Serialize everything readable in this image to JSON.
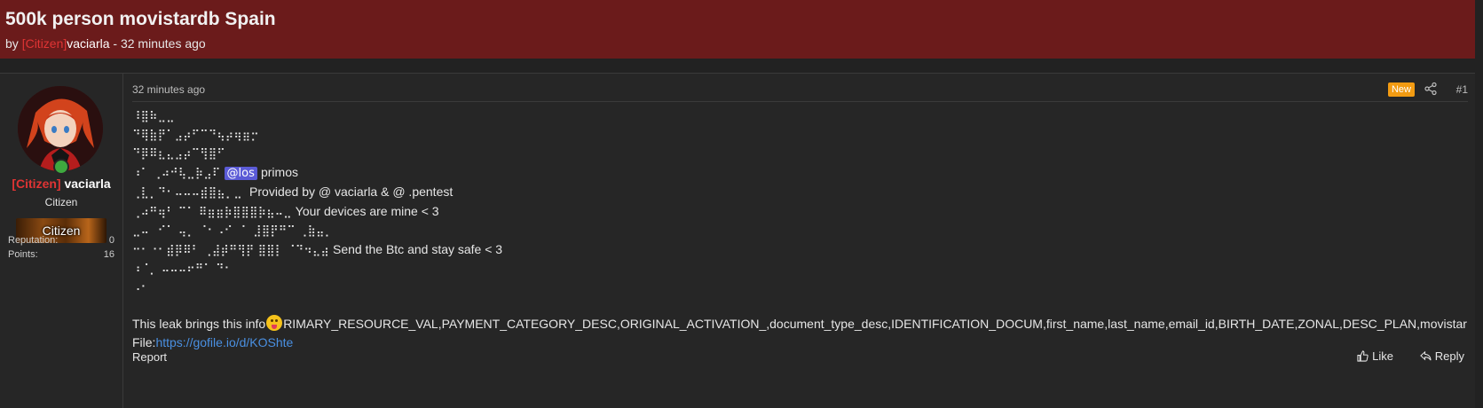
{
  "thread": {
    "title": "500k person movistardb Spain",
    "by_label": "by",
    "rank": "[Citizen]",
    "author": "vaciarla",
    "separator": "-",
    "time": "32 minutes ago"
  },
  "sidebar": {
    "rank": "[Citizen]",
    "username": "vaciarla",
    "user_title": "Citizen",
    "banner_text": "Citizen",
    "stats": [
      {
        "label": "Reputation:",
        "value": "0"
      },
      {
        "label": "Points:",
        "value": "16"
      }
    ]
  },
  "post": {
    "time": "32 minutes ago",
    "badge": "New",
    "number": "#1",
    "art_lines": [
      "⠸⣿⠷⣀⣀",
      "⠙⢿⣷⡟⠁⣠⡴⠋⠉⠙⢦⡴⢶⣶⡒",
      "⠙⡿⠿⣆⣄⣠⡴⠉⢻⣿⠋",
      "⠰⠁ ⢀⠴⠚⢧⣀⡷⣠⠏",
      "⢀⣇⡀⠙⠂⠤⠤⠤⣾⣿⣦⡀⣀",
      "⢀⠴⠛⢶⠃ ⠉⠁ ⠿⣶⣶⡷⣿⣿⣿⡷⣦⠤⣀",
      "⣀⠤⠀⠊⠁ ⢤⡀ ⠈⠂⠠⠊⠀⠁ ⣸⣿⡟⠛⠉ ⢀⣷⣤⡀",
      "⠒⠂⠐⠂⣾⡿⠿⠃ ⢀⣼⡾⠛⢻⡟ ⣿⣿⡇ ⠈⠙⠲⣄⣴",
      "⠰⠈⡀ ⠤⠤⠤⠖⠛⠁ ⠙⠂",
      "⠠⠂"
    ],
    "art_tails": [
      "",
      "",
      "",
      "primos",
      "Provided by @ vaciarla & @ .pentest",
      "Your devices are mine < 3",
      "",
      "Send the Btc and stay safe < 3",
      "",
      ""
    ],
    "mention": "@los",
    "leak_prefix": "This leak brings this info",
    "leak_fields": "RIMARY_RESOURCE_VAL,PAYMENT_CATEGORY_DESC,ORIGINAL_ACTIVATION_,document_type_desc,IDENTIFICATION_DOCUM,first_name,last_name,email_id,BIRTH_DATE,ZONAL,DESC_PLAN,movistar",
    "file_label": "File:",
    "file_link": "https://gofile.io/d/KOShte",
    "report_label": "Report",
    "like_label": "Like",
    "reply_label": "Reply"
  },
  "colors": {
    "header_bg": "#6b1b1b",
    "rank_red": "#e03434",
    "badge_orange": "#f29b12",
    "mention_bg": "#5b5bd6",
    "link_blue": "#4a90e2"
  },
  "icons": [
    "share-icon",
    "like-icon",
    "reply-icon",
    "online-status-icon",
    "tongue-emoji-icon"
  ]
}
